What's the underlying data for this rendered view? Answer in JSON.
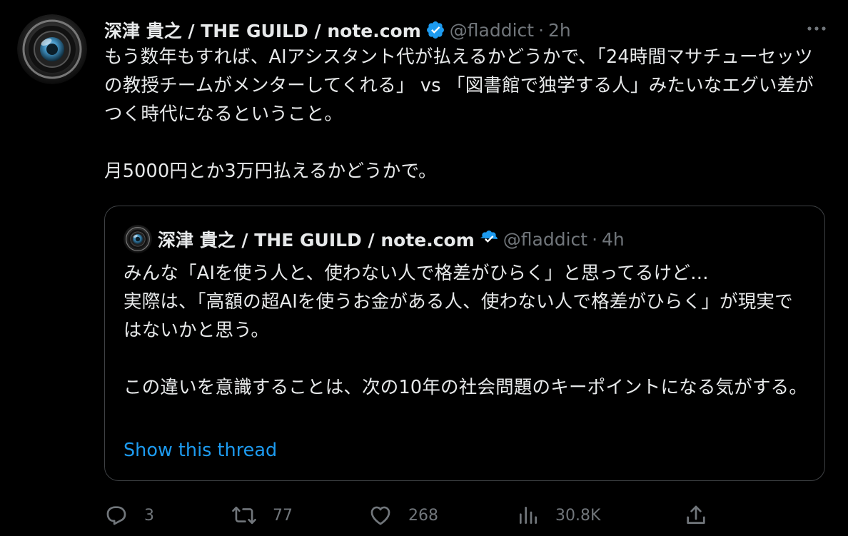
{
  "tweet": {
    "author": {
      "name": "深津 貴之 / THE GUILD / note.com",
      "handle": "@fladdict",
      "time": "2h"
    },
    "separator": "·",
    "text": "もう数年もすれば、AIアシスタント代が払えるかどうかで、「24時間マサチューセッツの教授チームがメンターしてくれる」 vs 「図書館で独学する人」みたいなエグい差がつく時代になるということ。\n\n月5000円とか3万円払えるかどうかで。",
    "quote": {
      "name": "深津 貴之 / THE GUILD / note.com",
      "handle": "@fladdict",
      "time": "4h",
      "text": "みんな「AIを使う人と、使わない人で格差がひらく」と思ってるけど…\n実際は、「高額の超AIを使うお金がある人、使わない人で格差がひらく」が現実ではないかと思う。\n\nこの違いを意識することは、次の10年の社会問題のキーポイントになる気がする。",
      "show_thread": "Show this thread"
    },
    "stats": {
      "replies": "3",
      "retweets": "77",
      "likes": "268",
      "views": "30.8K"
    }
  },
  "colors": {
    "background": "#000000",
    "text": "#e7e9ea",
    "secondary": "#71767b",
    "accent": "#1d9bf0",
    "border": "#3e4144"
  },
  "icons": {
    "verified": "verified-badge-icon",
    "more": "more-options-icon",
    "reply": "reply-icon",
    "retweet": "retweet-icon",
    "like": "like-icon",
    "views": "views-icon",
    "share": "share-icon"
  }
}
